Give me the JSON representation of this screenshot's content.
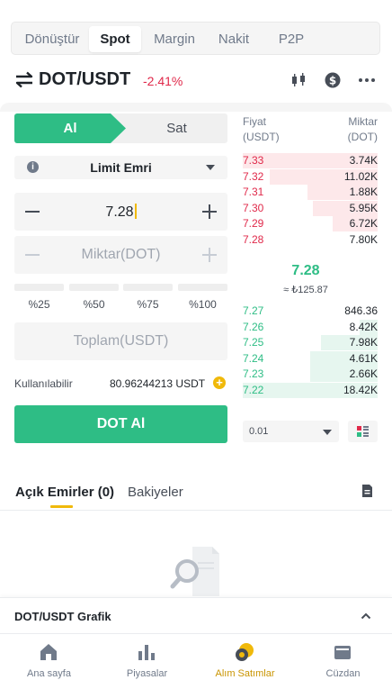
{
  "top_tabs": [
    {
      "label": "Dönüştür"
    },
    {
      "label": "Spot"
    },
    {
      "label": "Margin"
    },
    {
      "label": "Nakit"
    },
    {
      "label": "P2P"
    }
  ],
  "active_tab": "Spot",
  "pair": {
    "symbol": "DOT/USDT",
    "change": "-2.41%"
  },
  "header_icons": [
    "candlestick-chart-icon",
    "dollar-coin-icon",
    "more-icon"
  ],
  "trade_form": {
    "buy_label": "Al",
    "sell_label": "Sat",
    "order_type": "Limit Emri",
    "price_value": "7.28",
    "amount_placeholder": "Miktar(DOT)",
    "percents": [
      "%25",
      "%50",
      "%75",
      "%100"
    ],
    "total_placeholder": "Toplam(USDT)",
    "available_label": "Kullanılabilir",
    "available_value": "80.96244213 USDT",
    "submit_label": "DOT Al"
  },
  "order_book": {
    "price_header_1": "Fiyat",
    "price_header_2": "(USDT)",
    "qty_header_1": "Miktar",
    "qty_header_2": "(DOT)",
    "asks": [
      {
        "price": "7.33",
        "qty": "3.74K",
        "depth": 1.0
      },
      {
        "price": "7.32",
        "qty": "11.02K",
        "depth": 0.8
      },
      {
        "price": "7.31",
        "qty": "1.88K",
        "depth": 0.52
      },
      {
        "price": "7.30",
        "qty": "5.95K",
        "depth": 0.48
      },
      {
        "price": "7.29",
        "qty": "6.72K",
        "depth": 0.33
      },
      {
        "price": "7.28",
        "qty": "7.80K",
        "depth": 0.0
      }
    ],
    "mid_price": "7.28",
    "mid_fiat": "≈ ₺125.87",
    "bids": [
      {
        "price": "7.27",
        "qty": "846.36",
        "depth": 0.0
      },
      {
        "price": "7.26",
        "qty": "8.42K",
        "depth": 0.13
      },
      {
        "price": "7.25",
        "qty": "7.98K",
        "depth": 0.42
      },
      {
        "price": "7.24",
        "qty": "4.61K",
        "depth": 0.5
      },
      {
        "price": "7.23",
        "qty": "2.66K",
        "depth": 0.5
      },
      {
        "price": "7.22",
        "qty": "18.42K",
        "depth": 1.0
      }
    ],
    "depth_step": "0.01"
  },
  "orders_section": {
    "open_orders_tab": "Açık Emirler (0)",
    "balances_tab": "Bakiyeler"
  },
  "chart_bar": {
    "label": "DOT/USDT Grafik"
  },
  "bottom_nav": [
    {
      "label": "Ana sayfa",
      "icon": "home-icon"
    },
    {
      "label": "Piyasalar",
      "icon": "markets-icon"
    },
    {
      "label": "Alım Satımlar",
      "icon": "trade-icon"
    },
    {
      "label": "Cüzdan",
      "icon": "wallet-icon"
    }
  ],
  "colors": {
    "buy": "#2ebd85",
    "sell": "#e0294a",
    "accent": "#f0b90b"
  }
}
